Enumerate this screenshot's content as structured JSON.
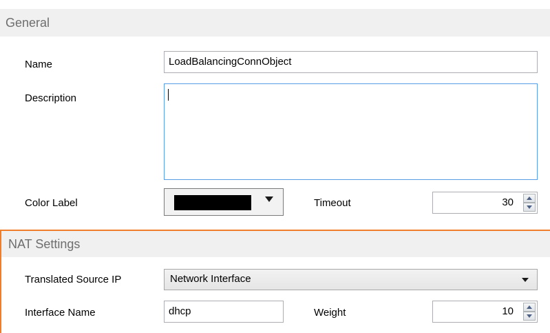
{
  "general": {
    "header": "General",
    "name_label": "Name",
    "name_value": "LoadBalancingConnObject",
    "description_label": "Description",
    "description_value": "",
    "color_label": "Color Label",
    "color_value": "#000000",
    "timeout_label": "Timeout",
    "timeout_value": "30"
  },
  "nat": {
    "header": "NAT Settings",
    "translated_source_ip_label": "Translated Source IP",
    "translated_source_ip_value": "Network Interface",
    "interface_name_label": "Interface Name",
    "interface_name_value": "dhcp",
    "weight_label": "Weight",
    "weight_value": "10"
  },
  "colors": {
    "accent": "#f07d2a",
    "focus_border": "#569de5",
    "header_bg": "#f0f0f0"
  }
}
